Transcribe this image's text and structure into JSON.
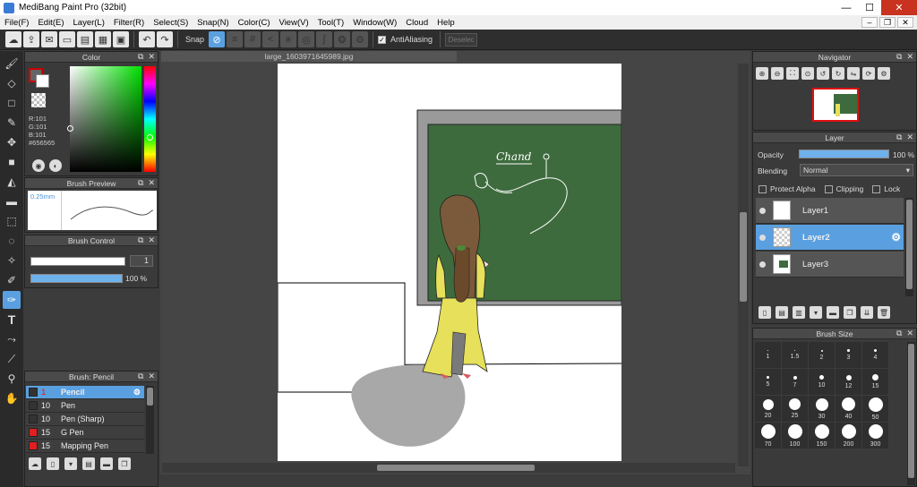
{
  "window": {
    "title": "MediBang Paint Pro (32bit)",
    "minimize": "—",
    "maximize": "☐",
    "close": "✕"
  },
  "menu": [
    "File(F)",
    "Edit(E)",
    "Layer(L)",
    "Filter(R)",
    "Select(S)",
    "Snap(N)",
    "Color(C)",
    "View(V)",
    "Tool(T)",
    "Window(W)",
    "Cloud",
    "Help"
  ],
  "toolbar": {
    "snap_label": "Snap",
    "antialias_label": "AntiAliasing",
    "deselect_label": "Deselec"
  },
  "color_panel": {
    "title": "Color",
    "r": "R:101",
    "g": "G:101",
    "b": "B:101",
    "hex": "#656565",
    "fg_color": "#656565"
  },
  "brush_preview": {
    "title": "Brush Preview",
    "size_label": "0.25mm"
  },
  "brush_control": {
    "title": "Brush Control",
    "size_value": "1",
    "opacity_value": "100 %"
  },
  "brush_list": {
    "title": "Brush: Pencil",
    "items": [
      {
        "size": "1",
        "name": "Pencil",
        "color": "#333333"
      },
      {
        "size": "10",
        "name": "Pen",
        "color": "#333333"
      },
      {
        "size": "10",
        "name": "Pen (Sharp)",
        "color": "#333333"
      },
      {
        "size": "15",
        "name": "G Pen",
        "color": "#e02020"
      },
      {
        "size": "15",
        "name": "Mapping Pen",
        "color": "#e02020"
      }
    ]
  },
  "document": {
    "tab_title": "large_1603971645989.jpg"
  },
  "navigator": {
    "title": "Navigator"
  },
  "layer_panel": {
    "title": "Layer",
    "opacity_label": "Opacity",
    "opacity_value": "100 %",
    "blending_label": "Blending",
    "blending_value": "Normal",
    "protect_alpha": "Protect Alpha",
    "clipping": "Clipping",
    "lock": "Lock",
    "layers": [
      {
        "name": "Layer1"
      },
      {
        "name": "Layer2"
      },
      {
        "name": "Layer3"
      }
    ]
  },
  "brush_size": {
    "title": "Brush Size",
    "sizes": [
      "1",
      "1.5",
      "2",
      "3",
      "4",
      "5",
      "7",
      "10",
      "12",
      "15",
      "20",
      "25",
      "30",
      "40",
      "50",
      "70",
      "100",
      "150",
      "200",
      "300"
    ]
  },
  "canvas_text": "Chand"
}
